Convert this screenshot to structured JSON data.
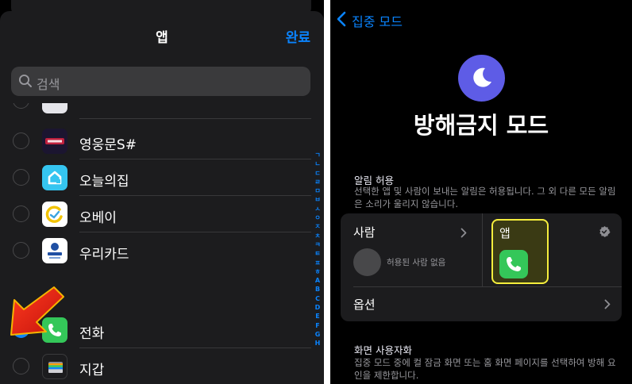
{
  "left": {
    "title": "앱",
    "done_label": "완료",
    "search": {
      "placeholder": "검색"
    },
    "partial_row_label": "",
    "rows": [
      {
        "label": "영웅문S#",
        "checked": false,
        "icon": "youngwoongmun-app-icon"
      },
      {
        "label": "오늘의집",
        "checked": false,
        "icon": "ohouse-app-icon"
      },
      {
        "label": "오베이",
        "checked": false,
        "icon": "obey-app-icon"
      },
      {
        "label": "우리카드",
        "checked": false,
        "icon": "woori-card-app-icon"
      },
      {
        "label": "전화",
        "checked": true,
        "icon": "phone-app-icon"
      },
      {
        "label": "지갑",
        "checked": false,
        "icon": "wallet-app-icon"
      }
    ],
    "index_letters": [
      "ㄱ",
      "ㄴ",
      "ㄷ",
      "ㄹ",
      "ㅁ",
      "ㅂ",
      "ㅅ",
      "ㅇ",
      "ㅈ",
      "ㅊ",
      "ㅋ",
      "ㅌ",
      "ㅍ",
      "ㅎ",
      "A",
      "B",
      "C",
      "D",
      "E",
      "F",
      "G",
      "H"
    ],
    "accent": "#0a84ff",
    "annotation_arrow_color": "#e8231c"
  },
  "right": {
    "back_label": "집중 모드",
    "focus_title": "방해금지 모드",
    "moon_color": "#5e5ce6",
    "allowed": {
      "title": "알림 허용",
      "description": "선택한 앱 및 사람이 보내는 알림은 허용됩니다. 그 외 다른 모든 알림은 소리가 울리지 않습니다.",
      "people_label": "사람",
      "people_empty": "허용된 사람 없음",
      "apps_label": "앱",
      "options_label": "옵션",
      "highlight_color": "#f5ee3c"
    },
    "customize": {
      "title": "화면 사용자화",
      "description": "집중 모드 중에 컬 잠금 화면 또는 홈 화면 페이지를 선택하여 방해 요인을 제한합니다."
    }
  }
}
